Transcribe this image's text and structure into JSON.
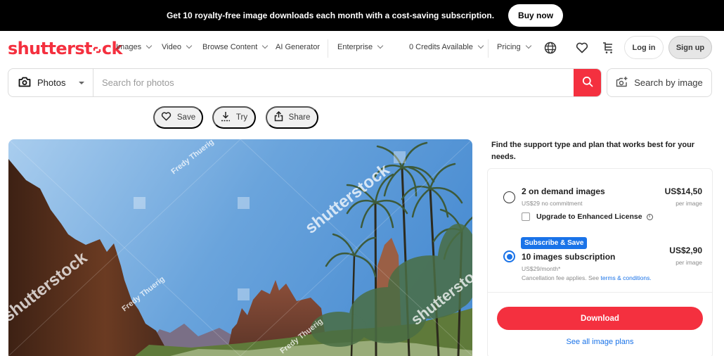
{
  "promo": {
    "text": "Get 10 royalty-free image downloads each month with a cost-saving subscription.",
    "button": "Buy now"
  },
  "brand": {
    "logo_text_a": "shutterst",
    "logo_text_b": "ck",
    "color": "#f4303f"
  },
  "nav": {
    "items": [
      {
        "label": "Images",
        "has_dropdown": true
      },
      {
        "label": "Video",
        "has_dropdown": true
      },
      {
        "label": "Browse Content",
        "has_dropdown": true
      },
      {
        "label": "AI Generator",
        "has_dropdown": false
      },
      {
        "label": "Enterprise",
        "has_dropdown": true
      },
      {
        "label": "0 Credits Available",
        "has_dropdown": true
      },
      {
        "label": "Pricing",
        "has_dropdown": true
      }
    ],
    "icons": [
      "globe-icon",
      "heart-icon",
      "cart-icon"
    ],
    "login": "Log in",
    "signup": "Sign up"
  },
  "search": {
    "type_label": "Photos",
    "placeholder": "Search for photos",
    "value": "",
    "by_image_label": "Search by image"
  },
  "actions": {
    "save": "Save",
    "try": "Try",
    "share": "Share"
  },
  "photo": {
    "watermark_brand": "shutterstock",
    "watermark_author": "Fredy Thuerig",
    "description": "Desert canyon with tall red rock formations, palm trees and blue sky"
  },
  "pricing": {
    "intro": "Find the support type and plan that works best for your needs.",
    "options": [
      {
        "title": "2 on demand images",
        "subtitle": "US$29 no commitment",
        "price": "US$14,50",
        "unit": "per image",
        "selected": false,
        "addon_label": "Upgrade to Enhanced License",
        "addon_checked": false
      },
      {
        "badge": "Subscribe & Save",
        "title": "10 images subscription",
        "subtitle": "US$29/month*",
        "note_prefix": "Cancellation fee applies. See ",
        "note_link": "terms & conditions.",
        "price": "US$2,90",
        "unit": "per image",
        "selected": true
      }
    ],
    "download_label": "Download",
    "see_all_label": "See all image plans",
    "accent_blue": "#1a73e8",
    "accent_red": "#f4303f"
  }
}
